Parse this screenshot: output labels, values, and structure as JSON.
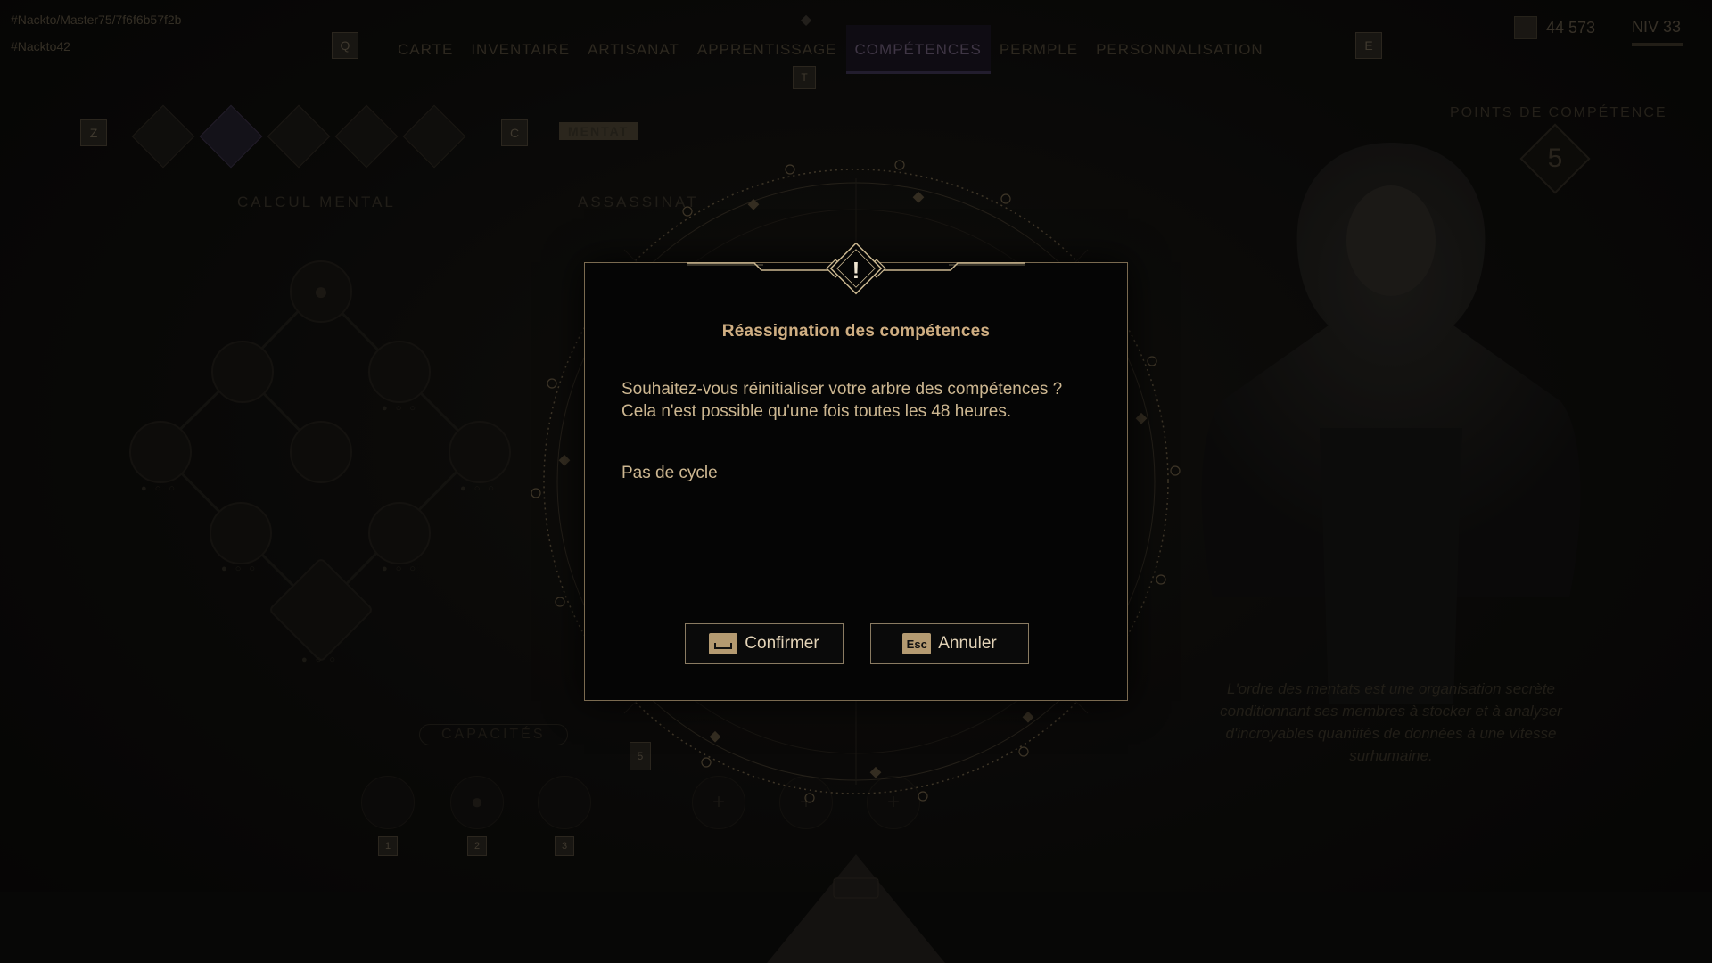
{
  "header": {
    "player_id": "#Nackto/Master75/7f6f6b57f2b",
    "player_sub": "#Nackto42",
    "left_key": "Q",
    "right_key": "E",
    "center_key": "T",
    "tabs": [
      {
        "label": "CARTE"
      },
      {
        "label": "INVENTAIRE"
      },
      {
        "label": "ARTISANAT"
      },
      {
        "label": "APPRENTISSAGE"
      },
      {
        "label": "COMPÉTENCES"
      },
      {
        "label": "PERMPLE"
      },
      {
        "label": "PERSONNALISATION"
      }
    ],
    "active_tab": "COMPÉTENCES",
    "currency": "44 573",
    "level": "NIV 33"
  },
  "skills": {
    "sub_tab_key_left": "Z",
    "sub_tab_key_right": "C",
    "mentat_tag": "MENTAT",
    "tree_left_title": "CALCUL MENTAL",
    "tree_right_title": "ASSASSINAT",
    "abilities_title": "CAPACITÉS",
    "ability_slot_keys": [
      "1",
      "2",
      "3"
    ],
    "ability_key_center": "5"
  },
  "right_panel": {
    "points_title": "POINTS DE COMPÉTENCE",
    "points_value": "5",
    "description": "L'ordre des mentats est une organisation secrète conditionnant ses membres à stocker et à analyser d'incroyables quantités de données à une vitesse surhumaine."
  },
  "dialog": {
    "title": "Réassignation des compétences",
    "body": "Souhaitez-vous réinitialiser votre arbre des compétences ? Cela n'est possible qu'une fois toutes les 48 heures.",
    "note": "Pas de cycle",
    "confirm_label": "Confirmer",
    "cancel_label": "Annuler",
    "cancel_key": "Esc",
    "warning_symbol": "!"
  },
  "colors": {
    "accent_gold": "#cfae82",
    "dialog_border": "#7a6a50",
    "key_badge": "#b49a71"
  },
  "icons": {
    "warning": "warning-diamond-icon",
    "confirm_key": "spacebar-key-icon"
  }
}
